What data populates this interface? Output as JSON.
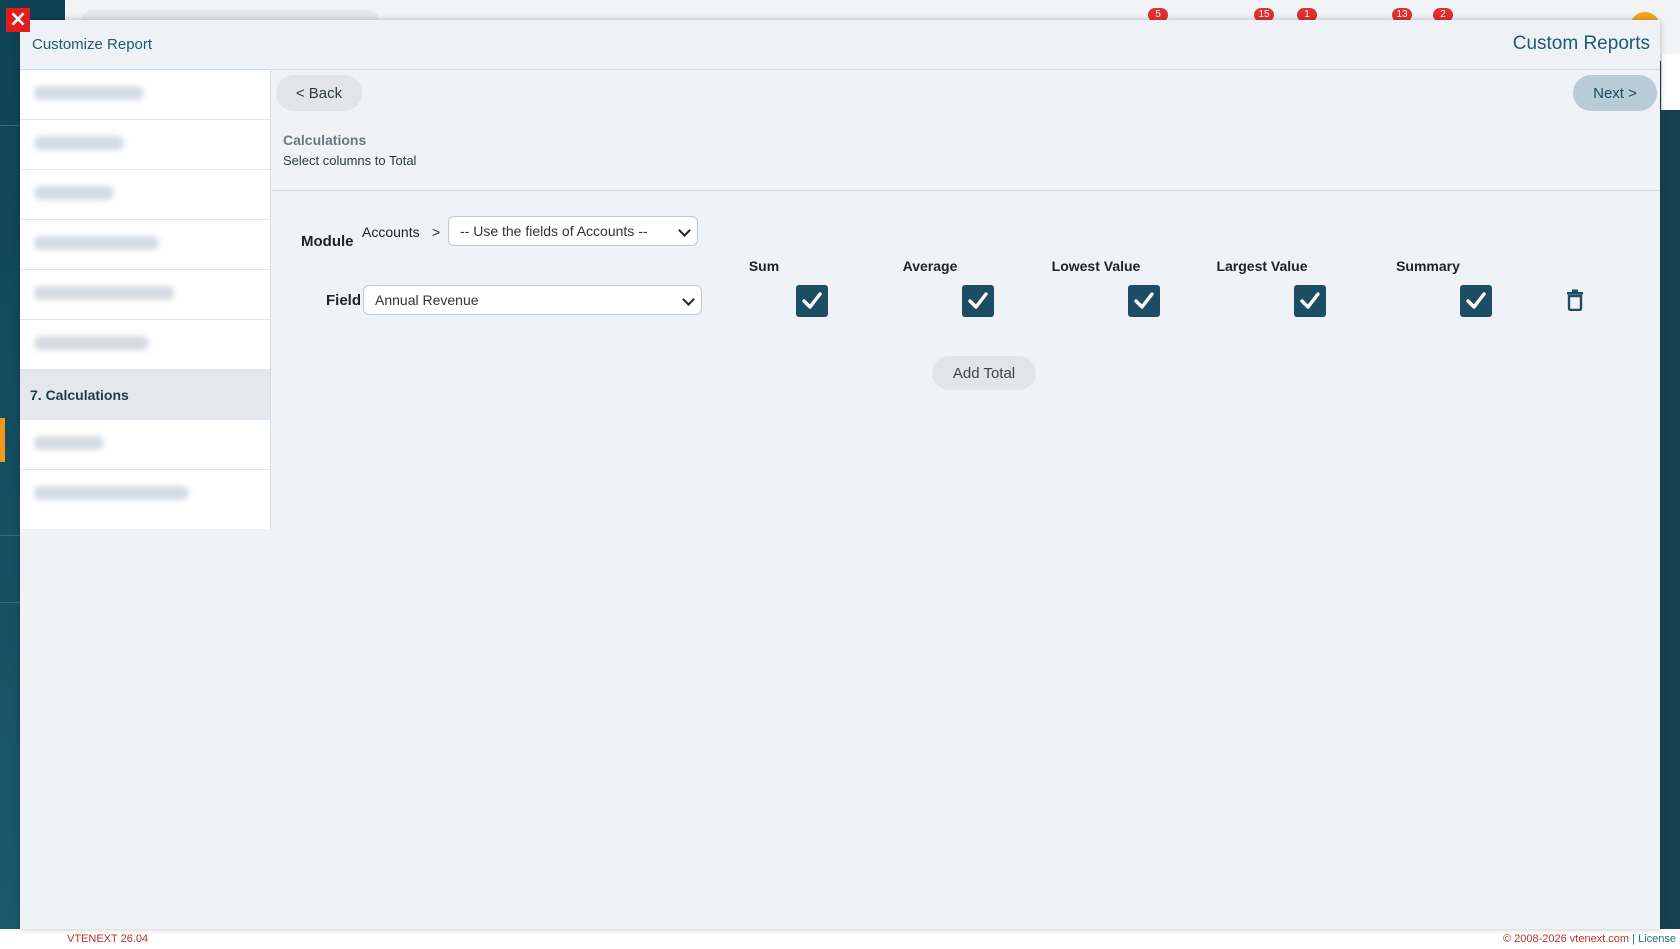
{
  "modal": {
    "title": "Customize Report",
    "title_right": "Custom Reports"
  },
  "steps": {
    "active_label": "7. Calculations"
  },
  "nav": {
    "back_label": "< Back",
    "next_label": "Next >"
  },
  "section": {
    "title": "Calculations",
    "subtitle": "Select columns to Total"
  },
  "module": {
    "label": "Module",
    "value": "Accounts",
    "separator": ">",
    "select_value": "-- Use the fields of Accounts --"
  },
  "field": {
    "label": "Field",
    "select_value": "Annual Revenue"
  },
  "columns": {
    "sum": "Sum",
    "average": "Average",
    "lowest": "Lowest Value",
    "largest": "Largest Value",
    "summary": "Summary"
  },
  "checks": {
    "sum": true,
    "average": true,
    "lowest": true,
    "largest": true,
    "summary": true
  },
  "actions": {
    "add_total_label": "Add Total"
  },
  "topbar_badges": {
    "b1": "5",
    "b2": "15",
    "b3": "1",
    "b4": "13",
    "b5": "2"
  },
  "footer": {
    "version": "VTENEXT 26.04",
    "copyright": "© 2008-2026 vtenext.com",
    "separator": " | ",
    "license": "License"
  },
  "icons": {
    "close": "close-icon",
    "trash": "trash-icon",
    "check": "check-icon"
  },
  "colors": {
    "accent": "#1c4d63",
    "title_color": "#1d5a74",
    "close_red": "#e21d1d",
    "badge_red": "#e2302f"
  }
}
